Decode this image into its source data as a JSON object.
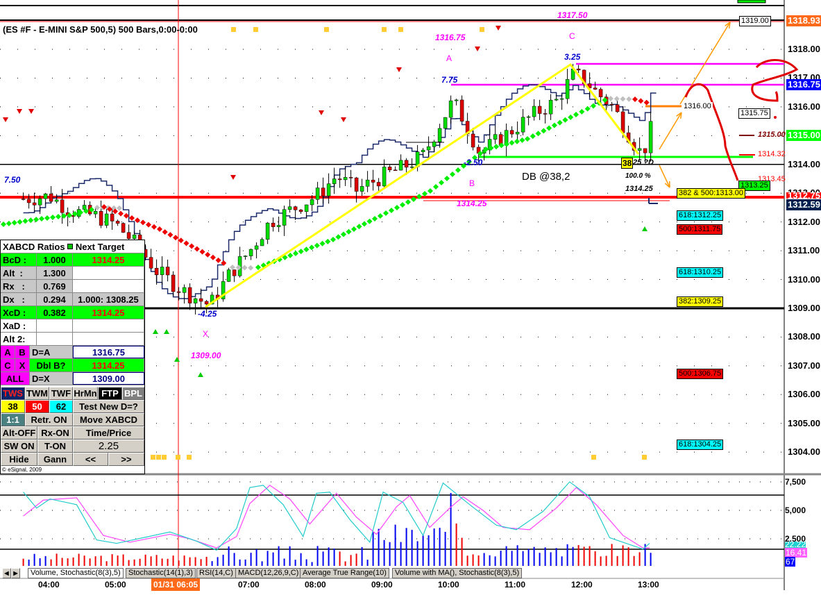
{
  "header": {
    "symbol_title": "(ES #F - E-MINI S&P 500,5) 500 Bars,0:00-0:00",
    "copyright": "© eSignal, 2009"
  },
  "colors": {
    "up": "#00dd00",
    "down": "#dd0000",
    "pattern": "#ffff00",
    "magenta": "#ff00ff",
    "bid": "#ff6a1a"
  },
  "price_axis": {
    "labels": [
      "1318.00",
      "1317.00",
      "1316.00",
      "1315.00",
      "1314.00",
      "1313.00",
      "1312.00",
      "1311.00",
      "1310.00",
      "1309.00",
      "1308.00",
      "1307.00",
      "1306.00",
      "1305.00",
      "1304.00"
    ],
    "last_high": "1318.93",
    "target_a": "1316.75",
    "target_15": "1315.00",
    "red_line": "1312.75",
    "last_price": "1312.59"
  },
  "target_labels": {
    "t1319": "1319.00",
    "t131575": "1315.75",
    "t1316": "1316.00",
    "t1315": "1315.00",
    "t131432": "1314.32",
    "t131345": "1313.45",
    "t131325": "1313.25",
    "fib1": "382 & 500:1313.00",
    "fib2": "618:1312.25",
    "fib3": "500:1311.75",
    "fib4": "618:1310.25",
    "fib5": "382:1309.25",
    "fib6": "500:1306.75",
    "fib7": "618:1304.25"
  },
  "annotations": {
    "c_price": "1317.50",
    "a_price": "1316.75",
    "c": "C",
    "a": "A",
    "b": "B",
    "b_price": "1314.25",
    "x": "X",
    "x_price": "1309.00",
    "c_ratio": "3.25",
    "a_ratio": "7.75",
    "b_ratio": "-2.50",
    "left_ratio": "7.50",
    "x_ratio": "-4.25",
    "db": "DB @38,2",
    "d_box": "38",
    "d_text": "25 ?D",
    "d_pct": "100.0 %",
    "d_price": "1314.25"
  },
  "xabcd": {
    "header_left": "XABCD Ratios",
    "header_right": "Next Target",
    "rows": [
      {
        "k": "BcD :",
        "v": "1.000",
        "t": "1314.25"
      },
      {
        "k": "Alt  :",
        "v": "1.300",
        "t": ""
      },
      {
        "k": "Rx   :",
        "v": "0.769",
        "t": ""
      },
      {
        "k": "Dx   :",
        "v": "0.294",
        "t": "1.000: 1308.25"
      },
      {
        "k": "XcD :",
        "v": "0.382",
        "t": "1314.25"
      },
      {
        "k": "XaD :",
        "v": "",
        "t": ""
      },
      {
        "k": "Alt 2:",
        "v": "",
        "t": ""
      }
    ],
    "pts": {
      "a": "A",
      "b": "B",
      "c": "C",
      "x": "X",
      "all": "ALL",
      "da": "D=A",
      "da_v": "1316.75",
      "dbl": "Dbl B?",
      "dbl_v": "1314.25",
      "dx": "D=X",
      "dx_v": "1309.00"
    },
    "buttons": {
      "tws": "TWS",
      "twm": "TWM",
      "twf": "TWF",
      "hrmn": "HrMn",
      "ftp": "FTP",
      "bpl": "BPL",
      "b38": "38",
      "b50": "50",
      "b62": "62",
      "test": "Test New D=?",
      "r11": "1:1",
      "retr": "Retr. ON",
      "move": "Move XABCD",
      "altoff": "Alt-OFF",
      "rxon": "Rx-ON",
      "tp": "Time/Price",
      "swon": "SW ON",
      "ton": "T-ON",
      "val": "2.25",
      "hide": "Hide",
      "gann": "Gann",
      "prev": "<<",
      "next": ">>"
    }
  },
  "lower": {
    "axis": [
      "7,500",
      "5,000",
      "2,500"
    ],
    "stoch_k": "22.22",
    "stoch_d": "16.41",
    "vol": "67"
  },
  "tabs": [
    "Volume, Stochastic(8(3),5)",
    "Stochastic(14(1),3)",
    "RSI(14,C)",
    "MACD(12,26,9,C)",
    "Average True Range(10)",
    "Volume with MA(), Stochastic(8(3),5)"
  ],
  "time_axis": {
    "ticks": [
      "04:00",
      "05:00",
      "07:00",
      "08:00",
      "09:00",
      "10:00",
      "11:00",
      "12:00",
      "13:00"
    ],
    "cursor": "01/31 06:05"
  },
  "chart_data": {
    "type": "candlestick",
    "title": "ES #F - E-MINI S&P 500,5",
    "ylim": [
      1303.5,
      1319.5
    ],
    "close_path": [
      [
        3.6,
        1312.8
      ],
      [
        4.0,
        1312.9
      ],
      [
        4.3,
        1312.4
      ],
      [
        4.7,
        1312.2
      ],
      [
        5.0,
        1311.9
      ],
      [
        5.3,
        1311.2
      ],
      [
        5.6,
        1310.3
      ],
      [
        6.0,
        1309.6
      ],
      [
        6.4,
        1309.1
      ],
      [
        6.7,
        1310.2
      ],
      [
        7.0,
        1311.0
      ],
      [
        7.3,
        1312.0
      ],
      [
        7.6,
        1312.4
      ],
      [
        8.0,
        1312.9
      ],
      [
        8.3,
        1313.6
      ],
      [
        8.6,
        1313.1
      ],
      [
        9.0,
        1313.6
      ],
      [
        9.3,
        1313.9
      ],
      [
        9.6,
        1314.3
      ],
      [
        9.85,
        1315.4
      ],
      [
        10.05,
        1316.2
      ],
      [
        10.2,
        1315.6
      ],
      [
        10.45,
        1314.4
      ],
      [
        10.7,
        1314.8
      ],
      [
        11.0,
        1315.3
      ],
      [
        11.3,
        1315.8
      ],
      [
        11.6,
        1316.2
      ],
      [
        11.85,
        1317.1
      ],
      [
        12.0,
        1317.0
      ],
      [
        12.2,
        1316.5
      ],
      [
        12.45,
        1316.0
      ],
      [
        12.65,
        1315.2
      ],
      [
        12.8,
        1314.6
      ],
      [
        12.9,
        1314.3
      ],
      [
        13.0,
        1315.2
      ]
    ],
    "stoch_k": [
      [
        3.6,
        6600
      ],
      [
        3.8,
        5200
      ],
      [
        4.0,
        6000
      ],
      [
        4.4,
        5500
      ],
      [
        4.7,
        2400
      ],
      [
        5.0,
        2100
      ],
      [
        5.4,
        2600
      ],
      [
        5.8,
        3100
      ],
      [
        6.2,
        2300
      ],
      [
        6.5,
        1500
      ],
      [
        6.8,
        3400
      ],
      [
        7.0,
        7000
      ],
      [
        7.2,
        7200
      ],
      [
        7.5,
        5500
      ],
      [
        7.8,
        2700
      ],
      [
        8.0,
        6500
      ],
      [
        8.2,
        6600
      ],
      [
        8.5,
        4200
      ],
      [
        8.8,
        2200
      ],
      [
        9.0,
        6600
      ],
      [
        9.3,
        5700
      ],
      [
        9.6,
        2800
      ],
      [
        9.9,
        7400
      ],
      [
        10.3,
        5500
      ],
      [
        10.7,
        3700
      ],
      [
        11.0,
        3300
      ],
      [
        11.4,
        4900
      ],
      [
        11.8,
        7500
      ],
      [
        12.1,
        6200
      ],
      [
        12.4,
        2600
      ],
      [
        12.7,
        2000
      ],
      [
        12.9,
        1600
      ],
      [
        13.0,
        2100
      ]
    ],
    "stoch_d": [
      [
        3.6,
        4500
      ],
      [
        3.9,
        5900
      ],
      [
        4.4,
        6100
      ],
      [
        4.8,
        2800
      ],
      [
        5.2,
        2200
      ],
      [
        5.8,
        2900
      ],
      [
        6.1,
        2500
      ],
      [
        6.5,
        1700
      ],
      [
        6.8,
        2700
      ],
      [
        7.0,
        5600
      ],
      [
        7.3,
        7200
      ],
      [
        7.6,
        6000
      ],
      [
        7.9,
        3800
      ],
      [
        8.3,
        6500
      ],
      [
        8.6,
        4400
      ],
      [
        8.9,
        2900
      ],
      [
        9.2,
        5300
      ],
      [
        9.4,
        6300
      ],
      [
        9.7,
        3500
      ],
      [
        10.0,
        5200
      ],
      [
        10.2,
        6200
      ],
      [
        10.5,
        5000
      ],
      [
        10.8,
        3500
      ],
      [
        11.2,
        3300
      ],
      [
        11.6,
        5200
      ],
      [
        11.9,
        7000
      ],
      [
        12.2,
        5500
      ],
      [
        12.6,
        2800
      ],
      [
        12.9,
        1700
      ],
      [
        13.0,
        1700
      ]
    ]
  }
}
